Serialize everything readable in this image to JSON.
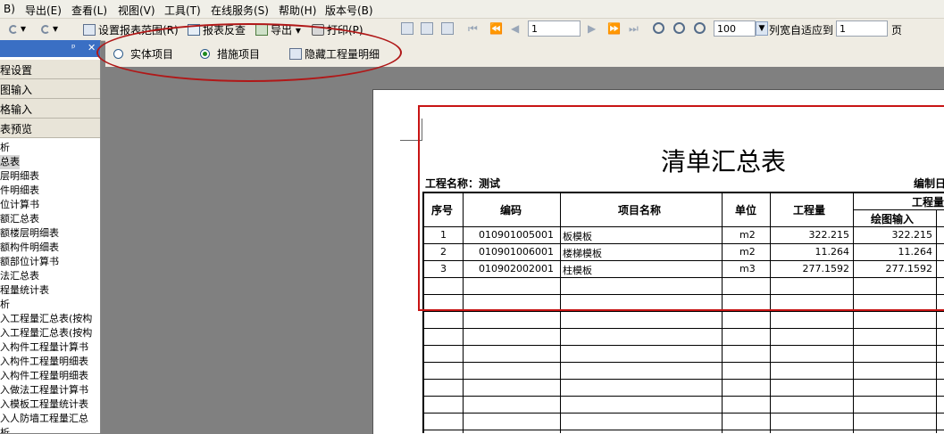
{
  "menu": {
    "items": [
      "B)",
      "导出(E)",
      "查看(L)",
      "视图(V)",
      "工具(T)",
      "在线服务(S)",
      "帮助(H)",
      "版本号(B)"
    ]
  },
  "toolbar": {
    "set_range": "设置报表范围(R)",
    "report_review": "报表反查",
    "export": "导出",
    "print": "打印(P)",
    "page_value": "1",
    "zoom_value": "100",
    "fit_label": "列宽自适应到",
    "fit_value": "1",
    "page_unit": "页"
  },
  "subbar": {
    "entity": "实体项目",
    "measures": "措施项目",
    "hide_detail": "隐藏工程量明细",
    "selected": "measures"
  },
  "panel": {
    "pin": "ᵖ",
    "close": "✕",
    "tabs": [
      "程设置",
      "图输入",
      "格输入",
      "表预览"
    ],
    "items": [
      "析",
      "总表",
      "层明细表",
      "件明细表",
      "位计算书",
      "额汇总表",
      "额楼层明细表",
      "额构件明细表",
      "额部位计算书",
      "法汇总表",
      "程量统计表",
      "析",
      "入工程量汇总表(按构",
      "入工程量汇总表(按构",
      "入构件工程量计算书",
      "入构件工程量明细表",
      "入构件工程量明细表",
      "入做法工程量计算书",
      "入模板工程量统计表",
      "入人防墙工程量汇总",
      "析"
    ]
  },
  "report": {
    "title": "清单汇总表",
    "project_label": "工程名称：测试",
    "date_label": "编制日",
    "headers": {
      "seq": "序号",
      "code": "编码",
      "name": "项目名称",
      "unit": "单位",
      "qty": "工程量",
      "qty_group": "工程量",
      "draw_input": "绘图输入"
    },
    "rows": [
      {
        "seq": "1",
        "code": "010901005001",
        "name": "板模板",
        "unit": "m2",
        "qty": "322.215",
        "draw": "322.215"
      },
      {
        "seq": "2",
        "code": "010901006001",
        "name": "楼梯模板",
        "unit": "m2",
        "qty": "11.264",
        "draw": "11.264"
      },
      {
        "seq": "3",
        "code": "010902002001",
        "name": "柱模板",
        "unit": "m3",
        "qty": "277.1592",
        "draw": "277.1592"
      }
    ]
  }
}
